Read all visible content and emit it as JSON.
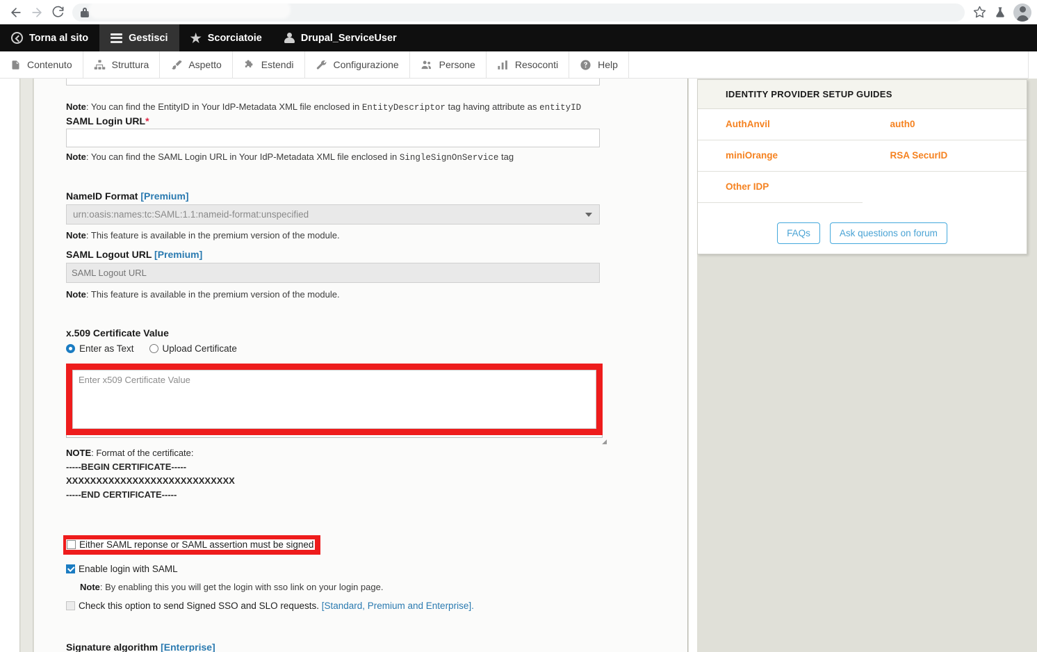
{
  "browser": {
    "back_icon": "back-arrow-icon",
    "forward_icon": "forward-arrow-icon",
    "reload_icon": "reload-icon",
    "lock_icon": "lock-icon",
    "url": "",
    "bookmark_icon": "star-icon",
    "experiments_icon": "flask-icon",
    "profile_icon": "avatar-icon"
  },
  "toolbar": {
    "back_to_site": "Torna al sito",
    "manage": "Gestisci",
    "shortcuts": "Scorciatoie",
    "user": "Drupal_ServiceUser"
  },
  "submenu": {
    "items": [
      {
        "label": "Contenuto",
        "icon": "document-icon"
      },
      {
        "label": "Struttura",
        "icon": "sitemap-icon"
      },
      {
        "label": "Aspetto",
        "icon": "paintbrush-icon"
      },
      {
        "label": "Estendi",
        "icon": "puzzle-icon"
      },
      {
        "label": "Configurazione",
        "icon": "wrench-icon"
      },
      {
        "label": "Persone",
        "icon": "people-icon"
      },
      {
        "label": "Resoconti",
        "icon": "bar-chart-icon"
      },
      {
        "label": "Help",
        "icon": "question-circle-icon"
      }
    ]
  },
  "form": {
    "entityid_note_prefix": "Note",
    "entityid_note": ": You can find the EntityID in Your IdP-Metadata XML file enclosed in ",
    "entityid_note_code1": "EntityDescriptor",
    "entityid_note_mid": " tag having attribute as ",
    "entityid_note_code2": "entityID",
    "saml_login_url_label": "SAML Login URL",
    "saml_login_url_required": "*",
    "saml_login_url_value": "",
    "saml_login_url_note_prefix": "Note",
    "saml_login_url_note": ": You can find the SAML Login URL in Your IdP-Metadata XML file enclosed in ",
    "saml_login_url_note_code": "SingleSignOnService",
    "saml_login_url_note_suffix": " tag",
    "nameid_format_label": "NameID Format ",
    "nameid_format_badge": "[Premium]",
    "nameid_format_value": "urn:oasis:names:tc:SAML:1.1:nameid-format:unspecified",
    "nameid_format_note_prefix": "Note",
    "nameid_format_note": ": This feature is available in the premium version of the module.",
    "saml_logout_url_label": "SAML Logout URL ",
    "saml_logout_url_badge": "[Premium]",
    "saml_logout_url_placeholder": "SAML Logout URL",
    "saml_logout_url_value": "",
    "saml_logout_note_prefix": "Note",
    "saml_logout_note": ": This feature is available in the premium version of the module.",
    "x509_label": "x.509 Certificate Value",
    "radio_enter_as_text": "Enter as Text",
    "radio_upload_certificate": "Upload Certificate",
    "x509_placeholder": "Enter x509 Certificate Value",
    "x509_value": "",
    "cert_note_prefix": "NOTE",
    "cert_note": ": Format of the certificate:",
    "cert_line_begin": "-----BEGIN CERTIFICATE-----",
    "cert_line_body": "XXXXXXXXXXXXXXXXXXXXXXXXXXXX",
    "cert_line_end": "-----END CERTIFICATE-----",
    "signed_checkbox_label": "Either SAML reponse or SAML assertion must be signed",
    "enable_login_label": "Enable login with SAML",
    "enable_login_note_prefix": "Note",
    "enable_login_note": ": By enabling this you will get the login with sso link on your login page.",
    "signed_sso_label": "Check this option to send Signed SSO and SLO requests. ",
    "signed_sso_link": "[Standard, Premium and Enterprise].",
    "signature_algorithm_label": "Signature algorithm ",
    "signature_algorithm_badge": "[Enterprise]"
  },
  "panel": {
    "title": "IDENTITY PROVIDER SETUP GUIDES",
    "idp_rows": [
      {
        "left": "AuthAnvil",
        "right": "auth0"
      },
      {
        "left": "miniOrange",
        "right": "RSA SecurID"
      },
      {
        "left": "Other IDP",
        "right": ""
      }
    ],
    "faqs_button": "FAQs",
    "forum_button": "Ask questions on forum"
  },
  "colors": {
    "highlight_red": "#ee1c1c",
    "accent_orange": "#f58220",
    "link_blue": "#2a7ab0",
    "button_blue": "#43a8dc",
    "toolbar_black": "#0f0f0f",
    "toolbar_active": "#333333",
    "page_bg": "#e0e0d8"
  }
}
